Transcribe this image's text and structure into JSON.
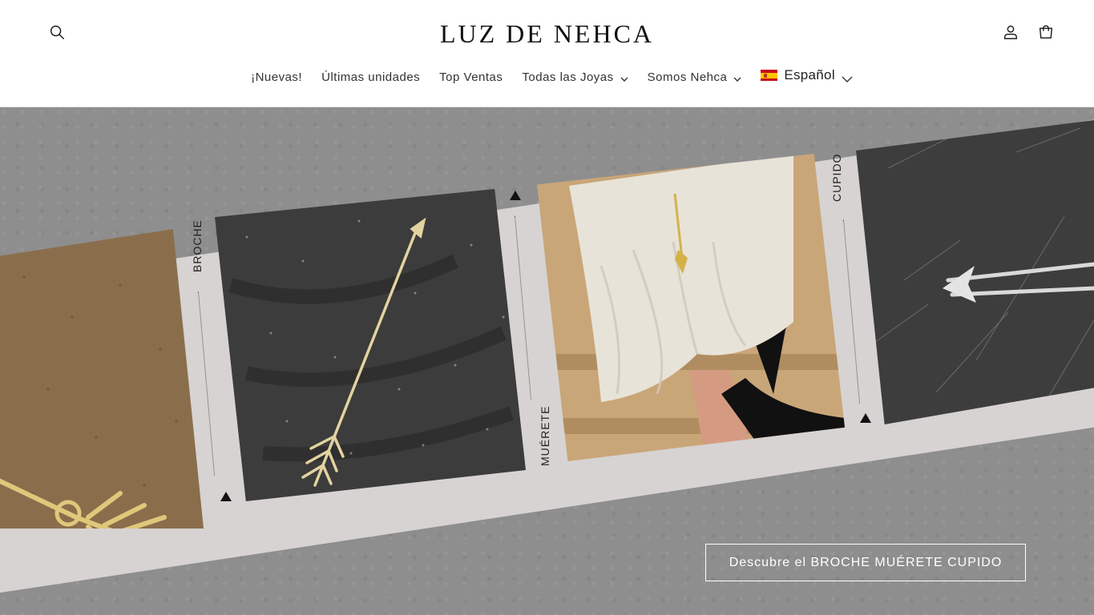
{
  "header": {
    "logo": "LUZ DE NEHCA",
    "icons": {
      "search": "search-icon",
      "account": "user-icon",
      "cart": "bag-icon"
    }
  },
  "nav": {
    "items": [
      {
        "label": "¡Nuevas!",
        "dropdown": false
      },
      {
        "label": "Últimas unidades",
        "dropdown": false
      },
      {
        "label": "Top Ventas",
        "dropdown": false
      },
      {
        "label": "Todas las Joyas",
        "dropdown": true
      },
      {
        "label": "Somos Nehca",
        "dropdown": true
      }
    ],
    "language": {
      "label": "Español",
      "flag": "spain-flag-icon"
    }
  },
  "hero": {
    "band_labels": {
      "left": "BROCHE",
      "middle": "MUÉRETE",
      "right": "CUPIDO"
    },
    "cta_label": "Descubre el BROCHE MUÉRETE CUPIDO",
    "colors": {
      "background": "#8e8e8e",
      "band": "#d6d3d2",
      "cta_text": "#ffffff"
    }
  }
}
